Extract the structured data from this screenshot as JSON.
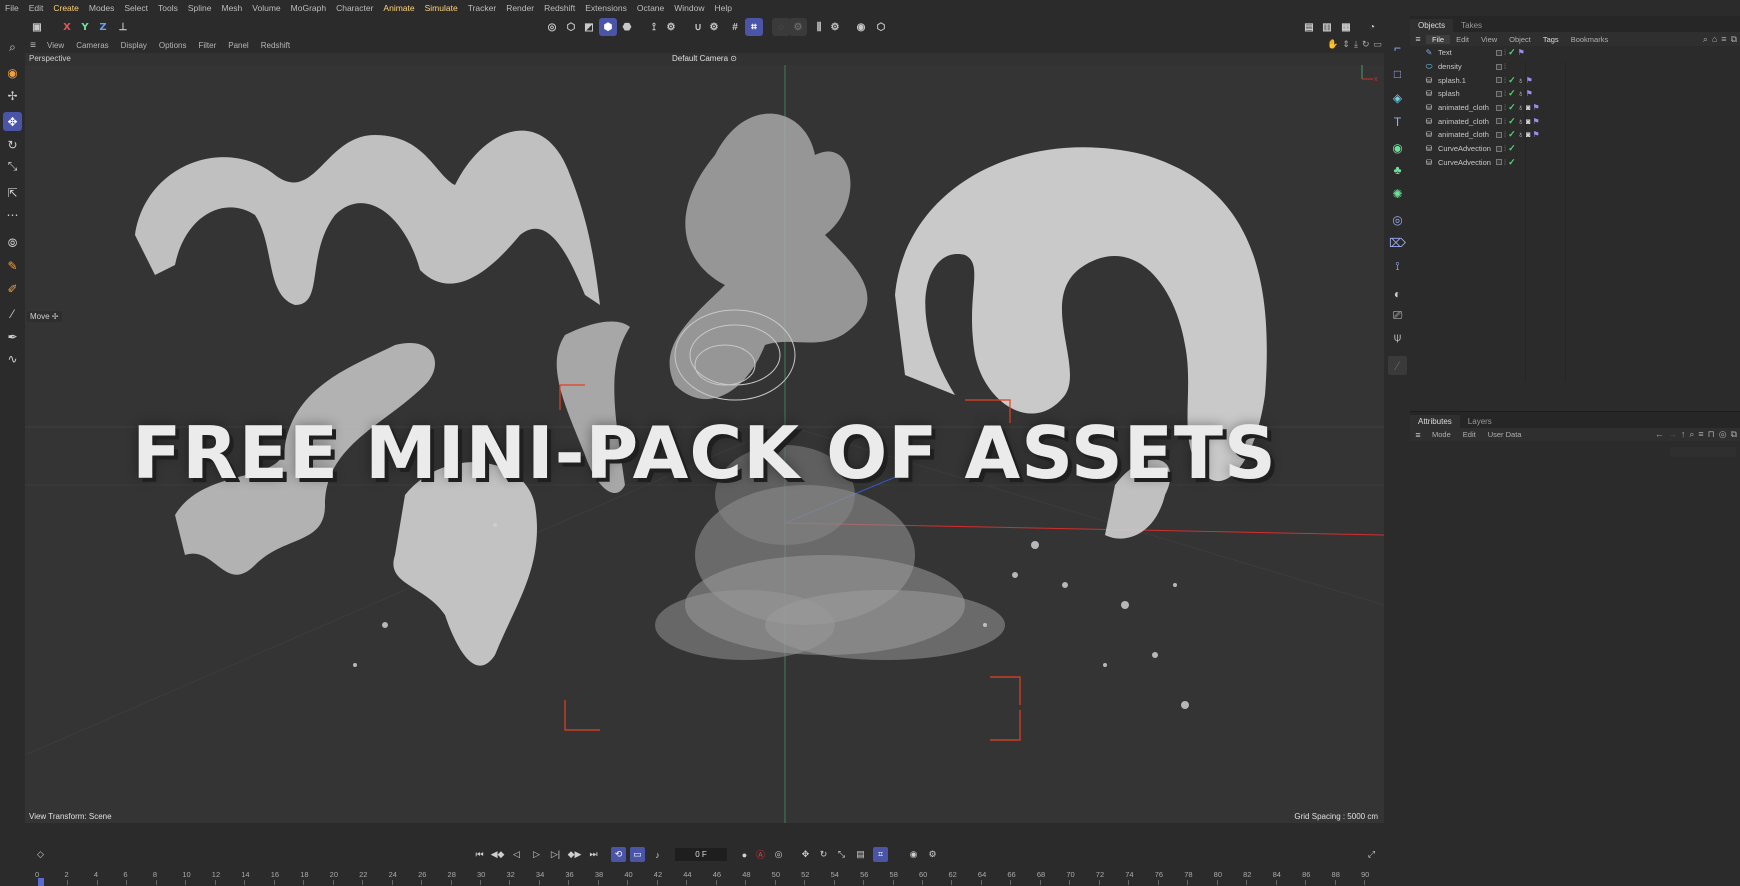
{
  "menu": [
    "File",
    "Edit",
    "Create",
    "Modes",
    "Select",
    "Tools",
    "Spline",
    "Mesh",
    "Volume",
    "MoGraph",
    "Character",
    "Animate",
    "Simulate",
    "Tracker",
    "Render",
    "Redshift",
    "Extensions",
    "Octane",
    "Window",
    "Help"
  ],
  "menu_highlight": [
    "Create",
    "Animate",
    "Simulate"
  ],
  "toolbar": {
    "axis_x": "X",
    "axis_y": "Y",
    "axis_z": "Z"
  },
  "viewport": {
    "menu": [
      "View",
      "Cameras",
      "Display",
      "Options",
      "Filter",
      "Panel",
      "Redshift"
    ],
    "perspective_label": "Perspective",
    "camera_label": "Default Camera",
    "camera_icon": "⊙",
    "overlay_title": "FREE MINI-PACK OF ASSETS",
    "move_label": "Move",
    "view_transform": "View Transform: Scene",
    "grid_spacing": "Grid Spacing : 5000 cm"
  },
  "timeline": {
    "current_frame": "0 F",
    "ticks": [
      "0",
      "2",
      "4",
      "6",
      "8",
      "10",
      "12",
      "14",
      "16",
      "18",
      "20",
      "22",
      "24",
      "26",
      "28",
      "30",
      "32",
      "34",
      "36",
      "38",
      "40",
      "42",
      "44",
      "46",
      "48",
      "50",
      "52",
      "54",
      "56",
      "58",
      "60",
      "62",
      "64",
      "66",
      "68",
      "70",
      "72",
      "74",
      "76",
      "78",
      "80",
      "82",
      "84",
      "86",
      "88",
      "90"
    ]
  },
  "objects_panel": {
    "tabs": [
      "Objects",
      "Takes"
    ],
    "menu": [
      "File",
      "Edit",
      "View",
      "Object",
      "Tags",
      "Bookmarks"
    ],
    "active_menu": "File",
    "items": [
      {
        "name": "Text",
        "icon": "text-icon",
        "tags": 0,
        "flag": true
      },
      {
        "name": "density",
        "icon": "density-icon",
        "tags": 0,
        "flag": false,
        "no_check": true
      },
      {
        "name": "splash.1",
        "icon": "mesh-icon",
        "tags": 1,
        "flag": true
      },
      {
        "name": "splash",
        "icon": "mesh-icon",
        "tags": 1,
        "flag": true
      },
      {
        "name": "animated_cloth",
        "icon": "mesh-icon",
        "tags": 2,
        "flag": true
      },
      {
        "name": "animated_cloth",
        "icon": "mesh-icon",
        "tags": 2,
        "flag": true
      },
      {
        "name": "animated_cloth",
        "icon": "mesh-icon",
        "tags": 2,
        "flag": true
      },
      {
        "name": "CurveAdvection",
        "icon": "mesh-icon",
        "tags": 0,
        "flag": false
      },
      {
        "name": "CurveAdvection",
        "icon": "mesh-icon",
        "tags": 0,
        "flag": false
      }
    ]
  },
  "attributes_panel": {
    "tabs": [
      "Attributes",
      "Layers"
    ],
    "menu": [
      "Mode",
      "Edit",
      "User Data"
    ]
  },
  "colors": {
    "accent": "#4a55a8",
    "check": "#52d46b",
    "tag_flag": "#9a8ff0",
    "y_axis": "#3fa06a",
    "x_axis": "#d03030"
  }
}
